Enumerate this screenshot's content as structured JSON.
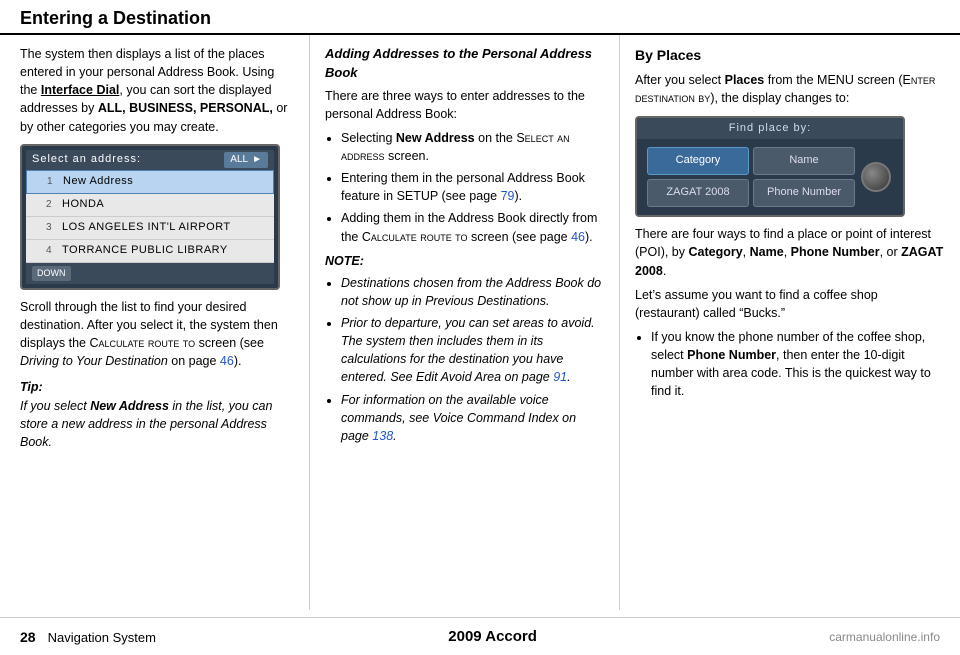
{
  "header": {
    "title": "Entering a Destination"
  },
  "footer": {
    "page_number": "28",
    "nav_label": "Navigation System",
    "center_text": "2009  Accord",
    "logo_text": "carmanualonline.info"
  },
  "left_column": {
    "intro": "The system then displays a list of the places entered in your personal Address Book. Using the ",
    "interface_dial": "Interface Dial",
    "intro2": ", you can sort the displayed addresses by ",
    "sort_categories": "ALL, BUSINESS, PERSONAL,",
    "intro3": " or by other categories you may create.",
    "nav_screen": {
      "title": "Select an address:",
      "badge": "ALL",
      "items": [
        {
          "num": "1",
          "label": "New Address",
          "selected": true
        },
        {
          "num": "2",
          "label": "HONDA"
        },
        {
          "num": "3",
          "label": "LOS ANGELES INT'L AIRPORT"
        },
        {
          "num": "4",
          "label": "TORRANCE PUBLIC LIBRARY"
        }
      ],
      "down_btn": "DOWN"
    },
    "scroll_text1": "Scroll through the list to find your desired destination. After you select it, the system then displays the ",
    "calculate_route": "Calculate route to",
    "scroll_text2": " screen (see ",
    "driving_text": "Driving to Your Destination",
    "page_ref1": "46",
    "scroll_text3": " on page ",
    "scroll_text4": ").",
    "tip_label": "Tip:",
    "tip_text1": "If you select ",
    "tip_new_address": "New Address",
    "tip_text2": " in the list, you can store a new address in the personal Address Book."
  },
  "middle_column": {
    "section_title": "Adding Addresses to the Personal Address Book",
    "intro": "There are three ways to enter addresses to the personal Address Book:",
    "bullet1_bold": "New Address",
    "bullet1_text": " on the ",
    "bullet1_screen": "Select an address",
    "bullet1_end": " screen.",
    "bullet2_text": "Entering them in the personal Address Book feature in SETUP (see page ",
    "bullet2_page": "79",
    "bullet2_end": ").",
    "bullet3_text": "Adding them in the Address Book directly from the ",
    "bullet3_calc": "Calculate route to",
    "bullet3_end": " screen (see page ",
    "bullet3_page": "46",
    "bullet3_end2": ").",
    "note_title": "NOTE:",
    "note_bullets": [
      "Destinations chosen from the Address Book do not show up in Previous Destinations.",
      "Prior to departure, you can set areas to avoid. The system then includes them in its calculations for the destination you have entered. See Edit Avoid Area on page 91.",
      "For information on the available voice commands, see Voice Command Index on page 138."
    ],
    "note_page91": "91",
    "note_page138": "138"
  },
  "right_column": {
    "section_title": "By Places",
    "intro_text1": "After you select ",
    "places_bold": "Places",
    "intro_text2": " from the MENU screen (",
    "enter_dest": "Enter destination by",
    "intro_text3": "), the display changes to:",
    "find_place_screen": {
      "title": "Find place by:",
      "cells": [
        {
          "label": "Category",
          "active": true
        },
        {
          "label": "Name",
          "active": false
        },
        {
          "label": "ZAGAT 2008",
          "active": false
        },
        {
          "label": "Phone Number",
          "active": false
        }
      ]
    },
    "four_ways_text": "There are four ways to find a place or point of interest (POI), by ",
    "category_bold": "Category",
    "comma1": ",",
    "name_bold": "Name",
    "comma2": ",",
    "phone_bold": "Phone Number",
    "or_text": ", or ",
    "zagat_bold": "ZAGAT 2008",
    "period": ".",
    "lets_assume": "Let’s assume you want to find a coffee shop (restaurant) called “Bucks.”",
    "bullet1_text": "If you know the phone number of the coffee shop, select ",
    "phone_number_bold": "Phone Number",
    "bullet1_end": ", then enter the 10-digit number with area code. This is the quickest way to find it."
  }
}
